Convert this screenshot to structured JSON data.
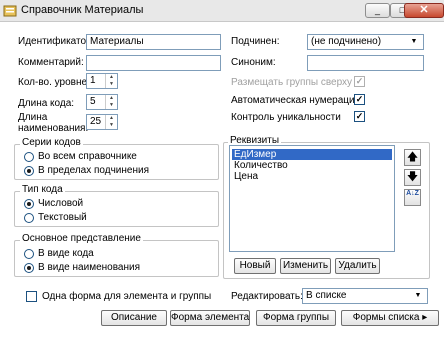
{
  "window": {
    "title": "Справочник Материалы",
    "close_glyph": "✕",
    "minimize_glyph": "_",
    "maximize_glyph": "□"
  },
  "form": {
    "identifier": {
      "label": "Идентификатор:",
      "value": "Материалы"
    },
    "comment": {
      "label": "Комментарий:",
      "value": ""
    },
    "subordinate": {
      "label": "Подчинен:",
      "value": "(не подчинено)"
    },
    "synonym": {
      "label": "Синоним:",
      "value": ""
    },
    "levels": {
      "label": "Кол-во. уровней:",
      "value": "1"
    },
    "code_length": {
      "label": "Длина кода:",
      "value": "5"
    },
    "name_length": {
      "label_line1": "Длина",
      "label_line2": "наименования:",
      "value": "25"
    },
    "groups_on_top": {
      "label": "Размещать группы сверху",
      "checked": true,
      "enabled": false
    },
    "auto_number": {
      "label": "Автоматическая нумерация",
      "checked": true
    },
    "uniqueness": {
      "label": "Контроль уникальности",
      "checked": true
    }
  },
  "code_series": {
    "title": "Серии кодов",
    "options": [
      "Во всем справочнике",
      "В пределах подчинения"
    ],
    "selected": 1
  },
  "code_type": {
    "title": "Тип кода",
    "options": [
      "Числовой",
      "Текстовый"
    ],
    "selected": 0
  },
  "representation": {
    "title": "Основное представление",
    "options": [
      "В виде кода",
      "В виде наименования"
    ],
    "selected": 1
  },
  "attributes": {
    "title": "Реквизиты",
    "items": [
      "ЕдИзмер",
      "Количество",
      "Цена"
    ],
    "selected": 0,
    "up_glyph": "🡅",
    "down_glyph": "🡇",
    "sort_glyph": "A↓Z",
    "new_label": "Новый",
    "edit_label": "Изменить",
    "delete_label": "Удалить"
  },
  "one_form": {
    "label": "Одна форма для элемента и группы",
    "checked": false
  },
  "edit_mode": {
    "label": "Редактировать:",
    "value": "В списке"
  },
  "buttons": {
    "description": "Описание",
    "element_form": "Форма элемента",
    "group_form": "Форма группы",
    "list_forms": "Формы списка",
    "list_forms_arrow": "▸"
  },
  "colors": {
    "selection": "#3169c6",
    "field_border": "#7f9db9"
  }
}
